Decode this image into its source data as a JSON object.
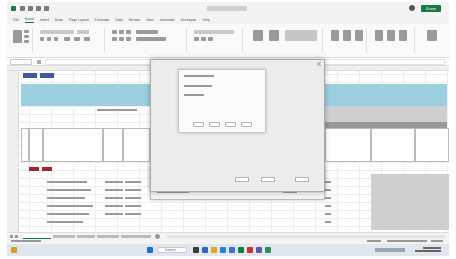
{
  "app": {
    "share_label": "Share"
  },
  "ribbon_tabs": [
    "File",
    "Home",
    "Insert",
    "Draw",
    "Page Layout",
    "Formulas",
    "Data",
    "Review",
    "View",
    "Automate",
    "Developer",
    "Help"
  ],
  "active_tab_index": 1,
  "taskbar": {
    "search_placeholder": "Search"
  },
  "colors": {
    "accent": "#1a7a45",
    "header_band": "#9ccfe0",
    "button_blue": "#3d5a9c",
    "button_red": "#a9242a"
  },
  "icons": {
    "windows_start": "windows-logo-icon",
    "excel_app": "excel-logo-icon"
  }
}
